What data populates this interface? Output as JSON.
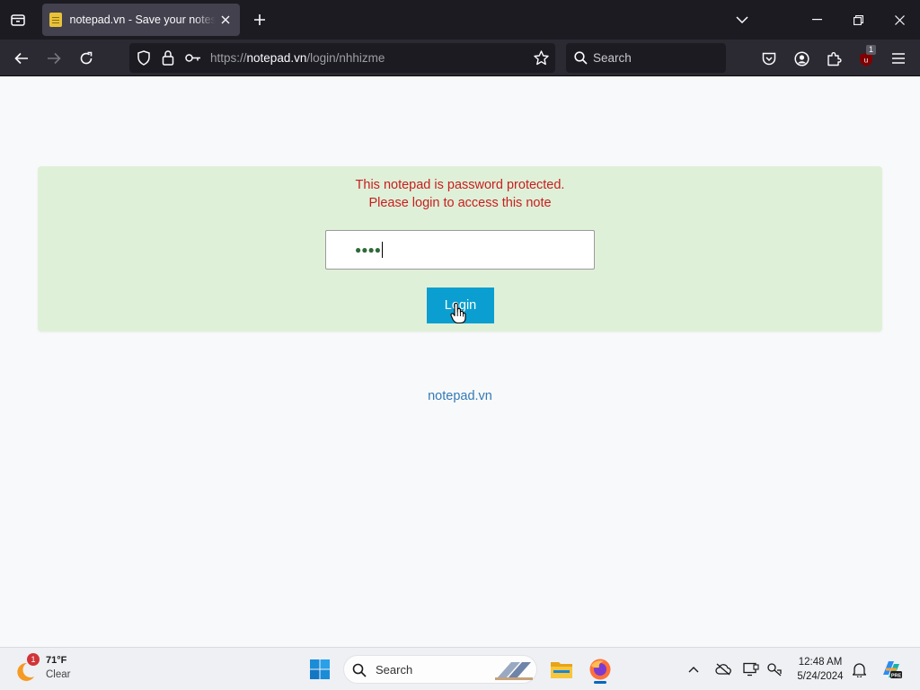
{
  "browser": {
    "tab": {
      "title": "notepad.vn - Save your notes, share your notes"
    },
    "url": {
      "scheme": "https://",
      "host": "notepad.vn",
      "path": "/login/nhhizme"
    },
    "search_placeholder": "Search",
    "extension_badge": "1"
  },
  "page": {
    "message_line1": "This notepad is password protected.",
    "message_line2": "Please login to access this note",
    "password_masked": "●●●●",
    "login_label": "Login",
    "footer_link": "notepad.vn"
  },
  "taskbar": {
    "weather_temp": "71°F",
    "weather_desc": "Clear",
    "weather_badge": "1",
    "search_placeholder": "Search",
    "time": "12:48 AM",
    "date": "5/24/2024"
  },
  "colors": {
    "panel_bg": "#dff0d8",
    "message": "#c81e1e",
    "button": "#0a9fd0",
    "link": "#337ab7"
  }
}
